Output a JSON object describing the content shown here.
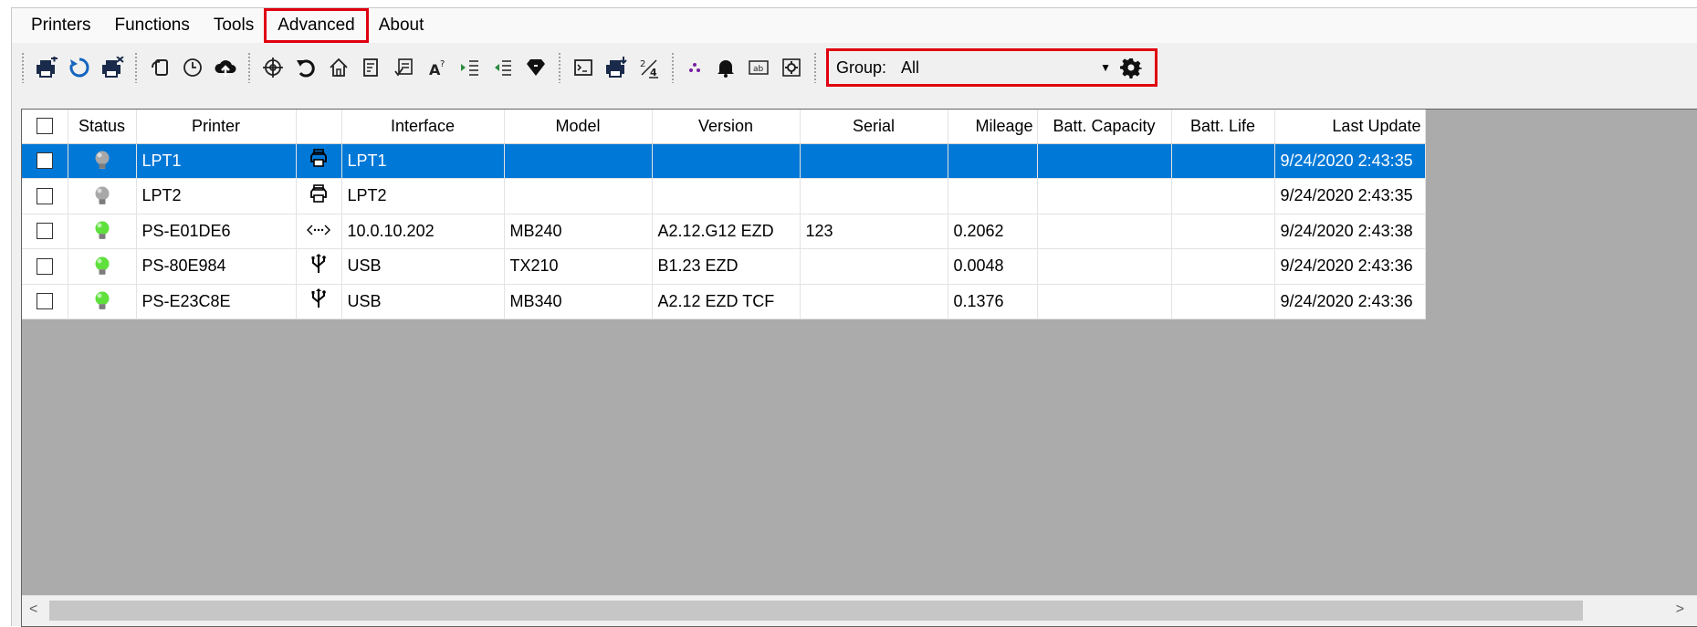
{
  "menu": {
    "printers": "Printers",
    "functions": "Functions",
    "tools": "Tools",
    "advanced": "Advanced",
    "about": "About"
  },
  "toolbar": {
    "group_label": "Group:",
    "group_value": "All"
  },
  "table": {
    "headers": {
      "status": "Status",
      "printer": "Printer",
      "interface": "Interface",
      "model": "Model",
      "version": "Version",
      "serial": "Serial",
      "mileage": "Mileage",
      "batt_capacity": "Batt. Capacity",
      "batt_life": "Batt. Life",
      "last_update": "Last Update"
    },
    "rows": [
      {
        "printer": "LPT1",
        "iface_icon": "printer-icon",
        "interface": "LPT1",
        "model": "",
        "version": "",
        "serial": "",
        "mileage": "",
        "batt_capacity": "",
        "batt_life": "",
        "last_update": "9/24/2020 2:43:35",
        "status": "offline",
        "selected": true
      },
      {
        "printer": "LPT2",
        "iface_icon": "printer-icon",
        "interface": "LPT2",
        "model": "",
        "version": "",
        "serial": "",
        "mileage": "",
        "batt_capacity": "",
        "batt_life": "",
        "last_update": "9/24/2020 2:43:35",
        "status": "offline",
        "selected": false
      },
      {
        "printer": "PS-E01DE6",
        "iface_icon": "network-icon",
        "interface": "10.0.10.202",
        "model": "MB240",
        "version": "A2.12.G12 EZD",
        "serial": "123",
        "mileage": "0.2062",
        "batt_capacity": "",
        "batt_life": "",
        "last_update": "9/24/2020 2:43:38",
        "status": "online",
        "selected": false
      },
      {
        "printer": "PS-80E984",
        "iface_icon": "usb-icon",
        "interface": "USB",
        "model": "TX210",
        "version": "B1.23 EZD",
        "serial": "",
        "mileage": "0.0048",
        "batt_capacity": "",
        "batt_life": "",
        "last_update": "9/24/2020 2:43:36",
        "status": "online",
        "selected": false
      },
      {
        "printer": "PS-E23C8E",
        "iface_icon": "usb-icon",
        "interface": "USB",
        "model": "MB340",
        "version": "A2.12 EZD TCF",
        "serial": "",
        "mileage": "0.1376",
        "batt_capacity": "",
        "batt_life": "",
        "last_update": "9/24/2020 2:43:36",
        "status": "online",
        "selected": false
      }
    ]
  },
  "colors": {
    "selection": "#0078d7",
    "highlight_box": "#e0000f",
    "status_online": "#5fe03c",
    "status_offline": "#a8a8a8"
  }
}
